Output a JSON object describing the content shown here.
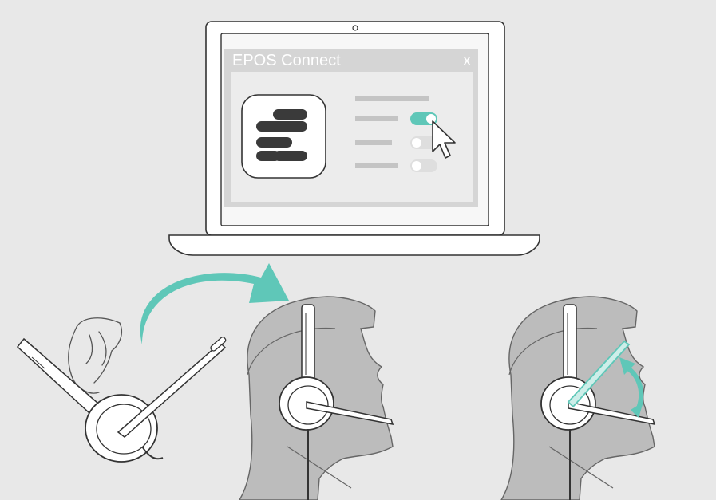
{
  "app_window": {
    "title": "EPOS Connect",
    "close_label": "x"
  },
  "settings": {
    "toggles": [
      {
        "state": "on"
      },
      {
        "state": "off"
      },
      {
        "state": "off"
      }
    ]
  },
  "colors": {
    "background": "#e8e8e8",
    "accent": "#5fc7b8",
    "logo_bars": "#3a3a3a",
    "line": "#333333",
    "head_shadow": "#bcbcbc"
  },
  "icons": [
    "laptop-icon",
    "app-logo-icon",
    "cursor-arrow-icon",
    "rotation-arrow-icon",
    "boom-adjust-arrow-icon",
    "headset-icon",
    "hand-icon"
  ]
}
